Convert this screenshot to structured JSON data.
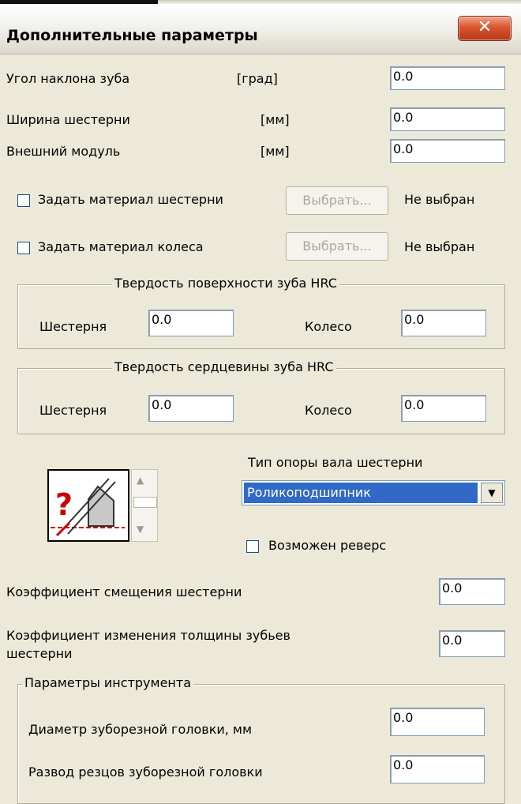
{
  "window": {
    "title": "Дополнительные параметры",
    "close_glyph": "✕"
  },
  "basic_params": [
    {
      "label": "Угол наклона зуба",
      "unit": "[град]",
      "value": "0.0"
    },
    {
      "label": "Ширина  шестерни",
      "unit": "[мм]",
      "value": "0.0"
    },
    {
      "label": "Внешний модуль",
      "unit": "[мм]",
      "value": "0.0"
    }
  ],
  "materials": {
    "gear": {
      "label": "Задать материал шестерни",
      "button": "Выбрать...",
      "status": "Не выбран",
      "checked": false
    },
    "wheel": {
      "label": "Задать материал колеса",
      "button": "Выбрать...",
      "status": "Не выбран",
      "checked": false
    }
  },
  "surface_hardness": {
    "title": "Твердость поверхности зуба HRC",
    "gear_label": "Шестерня",
    "gear_value": "0.0",
    "wheel_label": "Колесо",
    "wheel_value": "0.0"
  },
  "core_hardness": {
    "title": "Твердость сердцевины зуба HRC",
    "gear_label": "Шестерня",
    "gear_value": "0.0",
    "wheel_label": "Колесо",
    "wheel_value": "0.0"
  },
  "shaft_support": {
    "label": "Тип  опоры вала шестерни",
    "selected": "Роликоподшипник",
    "reverse_label": "Возможен реверс",
    "reverse_checked": false,
    "icon": "bearing-help-icon"
  },
  "coefficients": {
    "shift_label": "Коэффициент смещения шестерни",
    "shift_value": "0.0",
    "thickness_label_1": "Коэффициент изменения толщины зубьев",
    "thickness_label_2": "шестерни",
    "thickness_value": "0.0"
  },
  "tool_params": {
    "title": "Параметры инструмента",
    "diameter_label": "Диаметр зуборезной головки, мм",
    "diameter_value": "0.0",
    "spread_label": "Развод резцов зуборезной головки",
    "spread_value": "0.0"
  }
}
